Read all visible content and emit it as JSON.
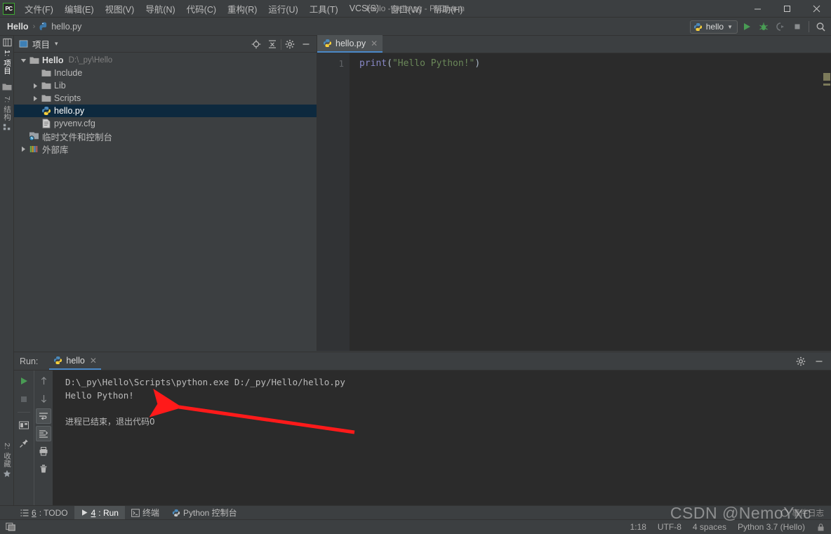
{
  "window": {
    "title": "Hello - hello.py - PyCharm",
    "app_badge": "PC",
    "minimize": "─",
    "maximize": "☐",
    "close": "✕"
  },
  "menu": {
    "items": [
      {
        "label": "文件(F)",
        "name": "menu-file"
      },
      {
        "label": "编辑(E)",
        "name": "menu-edit"
      },
      {
        "label": "视图(V)",
        "name": "menu-view"
      },
      {
        "label": "导航(N)",
        "name": "menu-navigate"
      },
      {
        "label": "代码(C)",
        "name": "menu-code"
      },
      {
        "label": "重构(R)",
        "name": "menu-refactor"
      },
      {
        "label": "运行(U)",
        "name": "menu-run"
      },
      {
        "label": "工具(T)",
        "name": "menu-tools"
      },
      {
        "label": "VCS(S)",
        "name": "menu-vcs"
      },
      {
        "label": "窗口(W)",
        "name": "menu-window"
      },
      {
        "label": "帮助(H)",
        "name": "menu-help"
      }
    ]
  },
  "navbar": {
    "breadcrumb": [
      {
        "label": "Hello",
        "icon": ""
      },
      {
        "label": "hello.py",
        "icon": "python-file-icon"
      }
    ],
    "separator": "›",
    "run_config": "hello",
    "dropdown_caret": "▼",
    "actions": [
      {
        "name": "run-button",
        "glyph": "▶",
        "color": "#3ea832"
      },
      {
        "name": "debug-button",
        "glyph": "bug",
        "color": "#4fa84f"
      },
      {
        "name": "run-coverage-button",
        "glyph": "coverage",
        "color": "#6e7275"
      },
      {
        "name": "stop-button",
        "glyph": "■",
        "color": "#8a8d8f"
      },
      {
        "name": "search-everywhere-button",
        "glyph": "⚲",
        "color": "#b5b5b5"
      }
    ]
  },
  "left_strip": {
    "tabs": [
      {
        "label": "1: 项目",
        "name": "tool-tab-project",
        "active": true
      },
      {
        "label": "7: 结构",
        "name": "tool-tab-structure",
        "active": false
      },
      {
        "label": "2: 收藏",
        "name": "tool-tab-favorites",
        "active": false
      }
    ]
  },
  "project_panel": {
    "title": "项目",
    "dropdown_caret": "▾",
    "header_icons": [
      {
        "name": "locate-file-icon",
        "glyph": "⊕"
      },
      {
        "name": "collapse-all-icon",
        "glyph": "≡"
      },
      {
        "name": "settings-gear-icon",
        "glyph": "⚙"
      },
      {
        "name": "hide-panel-icon",
        "glyph": "─"
      }
    ],
    "tree": [
      {
        "label": "Hello",
        "path": "D:\\_py\\Hello",
        "icon": "folder-icon",
        "indent": 0,
        "twisty": "open",
        "bold": true,
        "selected": false
      },
      {
        "label": "Include",
        "path": "",
        "icon": "folder-icon",
        "indent": 1,
        "twisty": "none",
        "bold": false,
        "selected": false
      },
      {
        "label": "Lib",
        "path": "",
        "icon": "folder-icon",
        "indent": 1,
        "twisty": "closed",
        "bold": false,
        "selected": false
      },
      {
        "label": "Scripts",
        "path": "",
        "icon": "folder-icon",
        "indent": 1,
        "twisty": "closed",
        "bold": false,
        "selected": false
      },
      {
        "label": "hello.py",
        "path": "",
        "icon": "python-file-icon",
        "indent": 1,
        "twisty": "none",
        "bold": false,
        "selected": true
      },
      {
        "label": "pyvenv.cfg",
        "path": "",
        "icon": "config-file-icon",
        "indent": 1,
        "twisty": "none",
        "bold": false,
        "selected": false
      },
      {
        "label": "临时文件和控制台",
        "path": "",
        "icon": "scratches-icon",
        "indent": 0,
        "twisty": "none",
        "bold": false,
        "selected": false
      },
      {
        "label": "外部库",
        "path": "",
        "icon": "library-icon",
        "indent": 0,
        "twisty": "closed",
        "bold": false,
        "selected": false
      }
    ]
  },
  "editor": {
    "tab": {
      "label": "hello.py",
      "icon": "python-file-icon",
      "close": "✕"
    },
    "lines": [
      {
        "number": "1",
        "tokens": [
          {
            "text": "print",
            "kind": "kw"
          },
          {
            "text": "(",
            "kind": "punct"
          },
          {
            "text": "\"Hello Python!\"",
            "kind": "str"
          },
          {
            "text": ")",
            "kind": "punct"
          }
        ]
      }
    ]
  },
  "run_panel": {
    "label": "Run:",
    "tab": {
      "label": "hello",
      "icon": "python-icon",
      "close": "✕"
    },
    "header_icons": [
      {
        "name": "settings-gear-icon",
        "glyph": "⚙"
      },
      {
        "name": "hide-panel-icon",
        "glyph": "─"
      }
    ],
    "tools_left": [
      {
        "name": "rerun-button",
        "glyph": "▶",
        "color": "#3ea832"
      },
      {
        "name": "stop-button",
        "glyph": "■",
        "color": "#5e6265"
      },
      {
        "name": "layout-button",
        "glyph": "layout",
        "color": "#b5b5b5"
      },
      {
        "name": "pin-tab-button",
        "glyph": "pin",
        "color": "#b5b5b5"
      }
    ],
    "tools_right": [
      {
        "name": "up-arrow-button",
        "glyph": "↑",
        "color": "#8b8e90"
      },
      {
        "name": "down-arrow-button",
        "glyph": "↓",
        "color": "#8b8e90"
      },
      {
        "name": "soft-wrap-button",
        "glyph": "wrap",
        "color": "#b5b5b5",
        "boxed": true
      },
      {
        "name": "scroll-to-end-button",
        "glyph": "scrollend",
        "color": "#b5b5b5",
        "boxed": true
      },
      {
        "name": "print-button",
        "glyph": "printer",
        "color": "#b5b5b5"
      },
      {
        "name": "clear-all-button",
        "glyph": "trash",
        "color": "#b5b5b5"
      }
    ],
    "console": [
      {
        "text": "D:\\_py\\Hello\\Scripts\\python.exe D:/_py/Hello/hello.py",
        "cn": false
      },
      {
        "text": "Hello Python!",
        "cn": false
      },
      {
        "text": "",
        "cn": false
      },
      {
        "text": "进程已结束，退出代码0",
        "cn": true
      }
    ],
    "annotation": {
      "name": "red-arrow-annotation",
      "color": "#ff1a1a"
    }
  },
  "bottom_tabs": [
    {
      "num": "6",
      "label": ": TODO",
      "icon": "todo-icon",
      "active": false,
      "name": "bottom-tab-todo"
    },
    {
      "num": "4",
      "label": ": Run",
      "icon": "run-icon",
      "active": true,
      "name": "bottom-tab-run"
    },
    {
      "num": "",
      "label": "终端",
      "icon": "terminal-icon",
      "active": false,
      "name": "bottom-tab-terminal"
    },
    {
      "num": "",
      "label": "Python 控制台",
      "icon": "python-icon",
      "active": false,
      "name": "bottom-tab-python-console"
    }
  ],
  "status_bar": {
    "left_icon": "toggle-toolbar-icon",
    "caret_position": "1:18",
    "encoding": "UTF-8",
    "indent": "4 spaces",
    "interpreter": "Python 3.7 (Hello)",
    "event_log": "事件日志",
    "watermark": "CSDN @NemoYxc"
  }
}
